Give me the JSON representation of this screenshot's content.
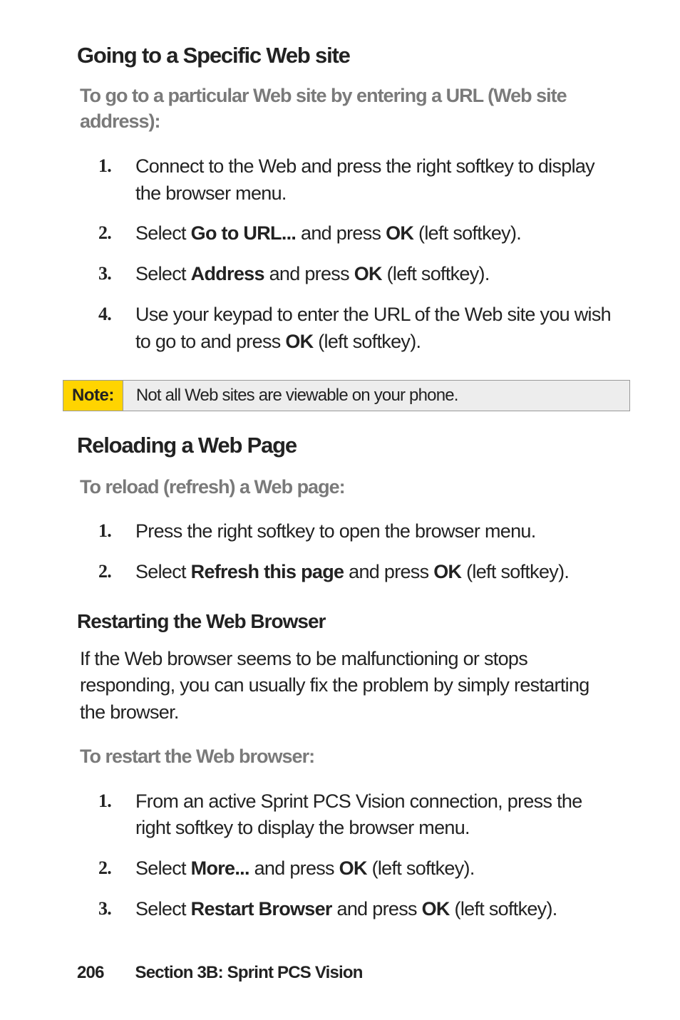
{
  "section1": {
    "heading": "Going to a Specific Web site",
    "instruction": "To go to a particular Web site by entering a URL (Web site address):",
    "steps": [
      {
        "num": "1.",
        "pre": "Connect to the Web and press the right softkey to display the browser menu."
      },
      {
        "num": "2.",
        "pre": "Select ",
        "bold1": "Go to URL...",
        "mid": " and press ",
        "bold2": "OK",
        "post": " (left softkey)."
      },
      {
        "num": "3.",
        "pre": "Select ",
        "bold1": "Address",
        "mid": " and press ",
        "bold2": "OK",
        "post": " (left softkey)."
      },
      {
        "num": "4.",
        "pre": "Use your keypad to enter the URL of the Web site you wish to go to and press ",
        "bold2": "OK",
        "post": " (left softkey)."
      }
    ]
  },
  "note": {
    "label": "Note:",
    "text": "Not all Web sites are viewable on your phone."
  },
  "section2": {
    "heading": "Reloading a Web Page",
    "instruction": "To reload (refresh) a Web page:",
    "steps": [
      {
        "num": "1.",
        "pre": "Press the right softkey to open the browser menu."
      },
      {
        "num": "2.",
        "pre": "Select ",
        "bold1": "Refresh this page",
        "mid": " and press ",
        "bold2": "OK",
        "post": " (left softkey)."
      }
    ]
  },
  "section3": {
    "heading": "Restarting the Web Browser",
    "body": "If the Web browser seems to be malfunctioning or stops responding, you can usually fix the problem by simply restarting the browser.",
    "instruction": "To restart the Web browser:",
    "steps": [
      {
        "num": "1.",
        "pre": "From an active Sprint PCS Vision connection, press the right softkey to display the browser menu."
      },
      {
        "num": "2.",
        "pre": "Select ",
        "bold1": "More...",
        "mid": " and press ",
        "bold2": "OK",
        "post": " (left softkey)."
      },
      {
        "num": "3.",
        "pre": "Select ",
        "bold1": "Restart Browser",
        "mid": " and press ",
        "bold2": "OK",
        "post": " (left softkey)."
      }
    ]
  },
  "footer": {
    "page": "206",
    "section": "Section 3B: Sprint PCS Vision"
  }
}
